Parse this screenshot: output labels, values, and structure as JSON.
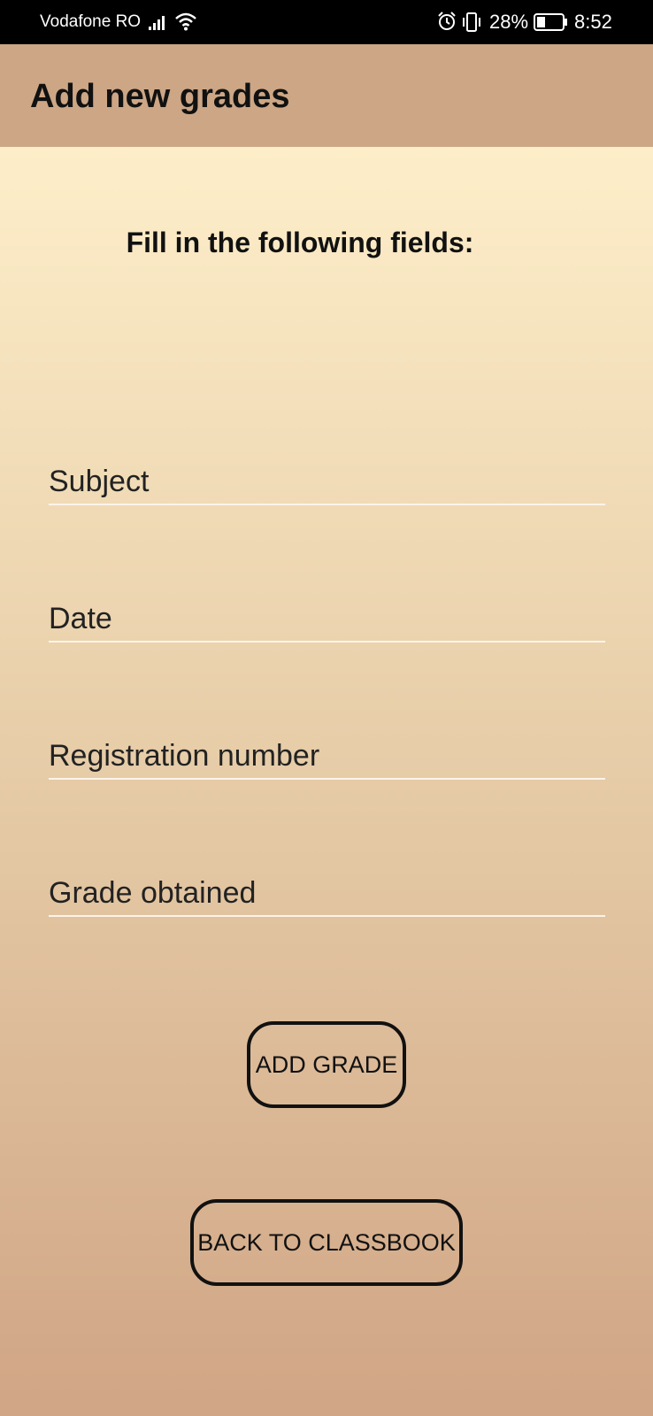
{
  "status_bar": {
    "carrier": "Vodafone RO",
    "battery": "28%",
    "time": "8:52",
    "icons": [
      "signal-icon",
      "wifi-icon",
      "alarm-icon",
      "vibrate-icon",
      "battery-icon"
    ]
  },
  "app_bar": {
    "title": "Add new grades"
  },
  "form": {
    "instruction": "Fill in the following fields:",
    "fields": [
      {
        "placeholder": "Subject",
        "value": ""
      },
      {
        "placeholder": "Date",
        "value": ""
      },
      {
        "placeholder": "Registration number",
        "value": ""
      },
      {
        "placeholder": "Grade obtained",
        "value": ""
      }
    ],
    "add_button": "ADD GRADE",
    "back_button": "BACK TO CLASSBOOK"
  },
  "colors": {
    "status_bar": "#000000",
    "app_bar": "#cda685",
    "gradient_top": "#fdeec9",
    "gradient_bottom": "#d0a585",
    "underline": "#fbf4ea"
  }
}
